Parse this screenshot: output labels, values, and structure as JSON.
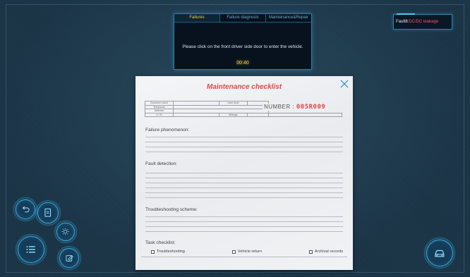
{
  "task_panel": {
    "tabs": [
      {
        "label": "Failures"
      },
      {
        "label": "Failure diagnosis"
      },
      {
        "label": "Maintenance&Repair"
      }
    ],
    "instruction": "Please click on the front driver side door to enter the vehicle.",
    "timer": "00:40"
  },
  "fault": {
    "prefix": "Fault8:",
    "value": "DC/DC leakage"
  },
  "checklist": {
    "title": "Maintenance checklist",
    "close_icon": "close-icon",
    "info": {
      "customer_name": "Customer name",
      "user_level": "User level",
      "telephone": "Telephone",
      "address": "Address",
      "vin": "V I N",
      "mileage": "Mileage"
    },
    "number_label": "NUMBER :",
    "number_value": "005R009",
    "sections": {
      "failure_phenomenon": "Failure phenomenon:",
      "fault_detection": "Fault detection:",
      "troubleshooting_scheme": "Troubleshooting scheme:",
      "task_checklist": "Task checklist:"
    },
    "tasks": [
      {
        "label": "Troubleshooting",
        "checked": false
      },
      {
        "label": "Vehicle return",
        "checked": false
      },
      {
        "label": "Archival records",
        "checked": false
      }
    ]
  },
  "buttons": {
    "back": "back-arrow-icon",
    "document": "document-icon",
    "light": "light-bulb-icon",
    "menu": "menu-list-icon",
    "edit": "edit-icon",
    "car": "car-icon"
  },
  "colors": {
    "accent": "#3aa6d6",
    "title_red": "#e04848",
    "timer": "#f0c94a",
    "fault_red": "#ff4d5e"
  }
}
